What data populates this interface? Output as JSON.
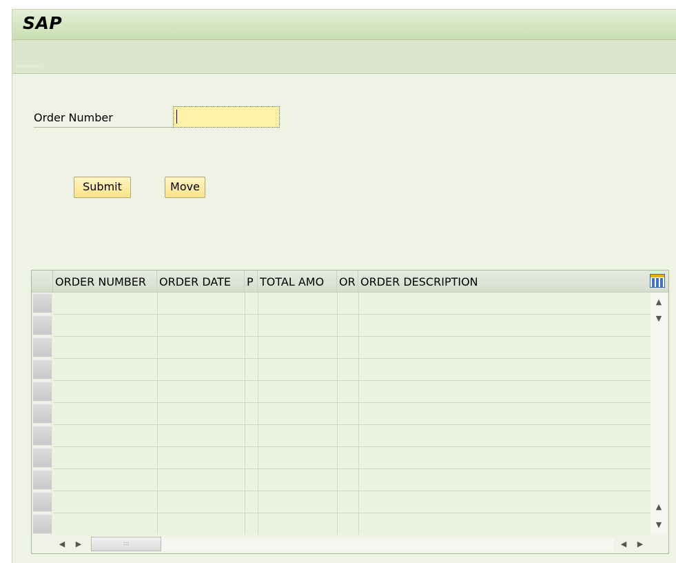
{
  "window": {
    "title": "SAP"
  },
  "form": {
    "order_number_label": "Order Number",
    "order_number_value": ""
  },
  "buttons": {
    "submit": "Submit",
    "move": "Move"
  },
  "table": {
    "columns": [
      "ORDER NUMBER",
      "ORDER DATE",
      "P",
      "TOTAL AMO",
      "OR",
      "ORDER DESCRIPTION"
    ],
    "rows": [],
    "empty_row_count": 11
  },
  "icons": {
    "column_settings": "column-settings-icon",
    "scroll_up": "▲",
    "scroll_down": "▼",
    "scroll_left": "◀",
    "scroll_right": "▶",
    "grip": ":::"
  },
  "colors": {
    "titlebar": "#c9dfb2",
    "background": "#eef3e5",
    "input_highlight": "#fff1a8",
    "button": "#fde38a"
  }
}
